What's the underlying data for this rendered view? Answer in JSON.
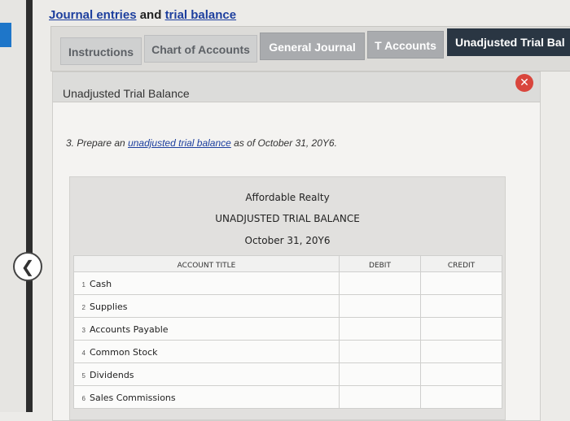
{
  "header": {
    "title_part1": "Journal entries",
    "title_mid": " and ",
    "title_part2": "trial balance"
  },
  "tabs": [
    {
      "label": "Instructions"
    },
    {
      "label": "Chart of Accounts"
    },
    {
      "label": "General Journal"
    },
    {
      "label": "T Accounts"
    },
    {
      "label": "Unadjusted Trial Bal"
    }
  ],
  "panel": {
    "title": "Unadjusted Trial Balance",
    "question_prefix": "3. Prepare an ",
    "question_link": "unadjusted trial balance",
    "question_suffix": " as of October 31, 20Y6."
  },
  "sheet": {
    "company": "Affordable Realty",
    "report": "UNADJUSTED TRIAL BALANCE",
    "date": "October 31, 20Y6",
    "columns": {
      "title": "ACCOUNT TITLE",
      "debit": "DEBIT",
      "credit": "CREDIT"
    },
    "rows": [
      {
        "num": "1",
        "account": "Cash"
      },
      {
        "num": "2",
        "account": "Supplies"
      },
      {
        "num": "3",
        "account": "Accounts Payable"
      },
      {
        "num": "4",
        "account": "Common Stock"
      },
      {
        "num": "5",
        "account": "Dividends"
      },
      {
        "num": "6",
        "account": "Sales Commissions"
      }
    ]
  },
  "icons": {
    "back": "chevron-left-icon",
    "close": "close-icon"
  },
  "colors": {
    "link": "#1d3f9e",
    "active_tab": "#2a3643",
    "close": "#d9463d"
  }
}
